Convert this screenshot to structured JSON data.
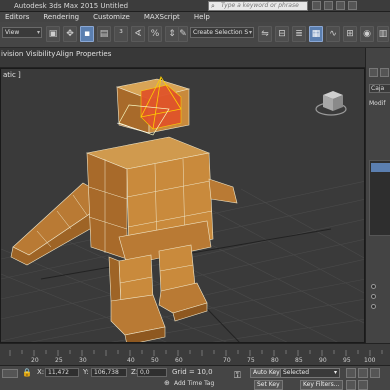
{
  "window": {
    "title": "Autodesk 3ds Max  2015    Untitled",
    "search_placeholder": "Type a keyword or phrase"
  },
  "menu": {
    "items": [
      {
        "label": "Editors"
      },
      {
        "label": "Rendering"
      },
      {
        "label": "Customize"
      },
      {
        "label": "MAXScript"
      },
      {
        "label": "Help"
      }
    ]
  },
  "toolbar": {
    "view_dropdown": "View",
    "selection_set_dropdown": "Create Selection S"
  },
  "ribbon": {
    "tabs": [
      {
        "label": "ivision"
      },
      {
        "label": "Visibility"
      },
      {
        "label": "Align"
      },
      {
        "label": "Properties"
      }
    ]
  },
  "viewport": {
    "label": "atic ]"
  },
  "command_panel": {
    "name_field": "Caja",
    "modifier_label": "Modif"
  },
  "timeline": {
    "tick_labels": [
      "20",
      "25",
      "30",
      "40",
      "50",
      "60",
      "70",
      "75",
      "80",
      "85",
      "90",
      "95",
      "100"
    ]
  },
  "status": {
    "x_label": "X:",
    "x_value": "11,472",
    "y_label": "Y:",
    "y_value": "106,738",
    "z_label": "Z:",
    "z_value": "0,0",
    "grid_label": "Grid = 10,0",
    "add_time_tag": "Add Time Tag",
    "auto_key": "Auto Key",
    "selected_dropdown": "Selected",
    "set_key": "Set Key",
    "key_filters": "Key Filters..."
  },
  "colors": {
    "mesh_orange": "#c98a3c",
    "selected_box": "#e0542a",
    "viewport_bg": "#3a3a3a",
    "grid_line": "#4c4c4c",
    "accent_blue": "#5b7fb0"
  }
}
